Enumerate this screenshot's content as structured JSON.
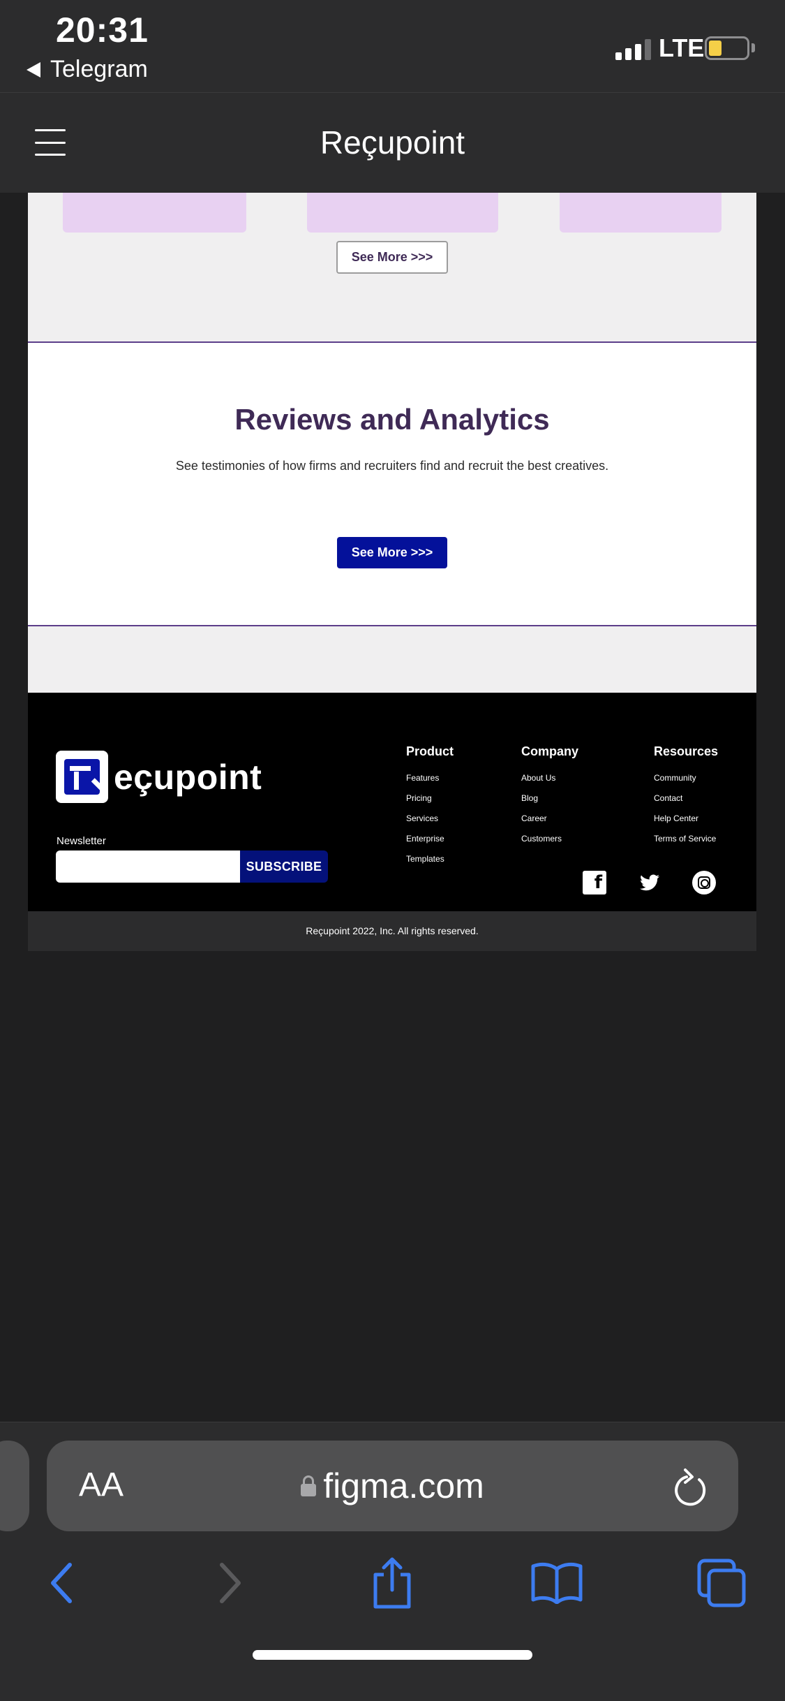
{
  "status_bar": {
    "time": "20:31",
    "back_app": "Telegram",
    "network": "LTE"
  },
  "site_header": {
    "title": "Reçupoint"
  },
  "features_section": {
    "see_more_label": "See More >>>"
  },
  "reviews_section": {
    "title": "Reviews and Analytics",
    "subtitle": "See testimonies of how firms and recruiters find and recruit the best creatives.",
    "see_more_label": "See More >>>"
  },
  "footer": {
    "logo_text": "eçupoint",
    "newsletter_label": "Newsletter",
    "newsletter_placeholder": "",
    "subscribe_label": "SUBSCRIBE",
    "columns": [
      {
        "title": "Product",
        "links": [
          "Features",
          "Pricing",
          "Services",
          "Enterprise",
          "Templates"
        ]
      },
      {
        "title": "Company",
        "links": [
          "About Us",
          "Blog",
          "Career",
          "Customers"
        ]
      },
      {
        "title": "Resources",
        "links": [
          "Community",
          "Contact",
          "Help Center",
          "Terms of Service"
        ]
      }
    ],
    "social_icons": [
      "facebook-icon",
      "twitter-icon",
      "instagram-icon"
    ],
    "copyright": "Reçupoint 2022, Inc. All rights reserved."
  },
  "safari": {
    "text_size_label": "AA",
    "url": "figma.com"
  },
  "colors": {
    "brand_primary": "#04119a",
    "brand_purple": "#3f2a56",
    "card_lavender": "#e8d1f2",
    "battery_yellow": "#f5cf48",
    "safari_accent": "#3d7cf0"
  }
}
